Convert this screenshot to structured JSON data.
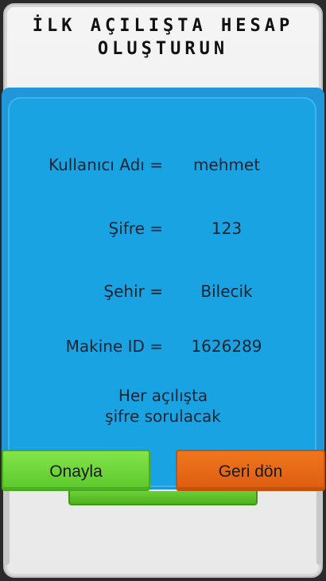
{
  "title": "İLK AÇILIŞTA HESAP\nOLUŞTURUN",
  "fields": [
    {
      "label": "Kullanıcı Adı =",
      "value": "mehmet"
    },
    {
      "label": "Şifre =",
      "value": "123"
    },
    {
      "label": "Şehir =",
      "value": "Bilecik"
    },
    {
      "label": "Makine ID =",
      "value": "1626289"
    }
  ],
  "note": "Her açılışta\nşifre sorulacak",
  "buttons": {
    "confirm": "Onayla",
    "back": "Geri dön"
  },
  "colors": {
    "panel_blue": "#1aa3e3",
    "confirm_green": "#6fd63a",
    "back_orange": "#e8681a"
  }
}
